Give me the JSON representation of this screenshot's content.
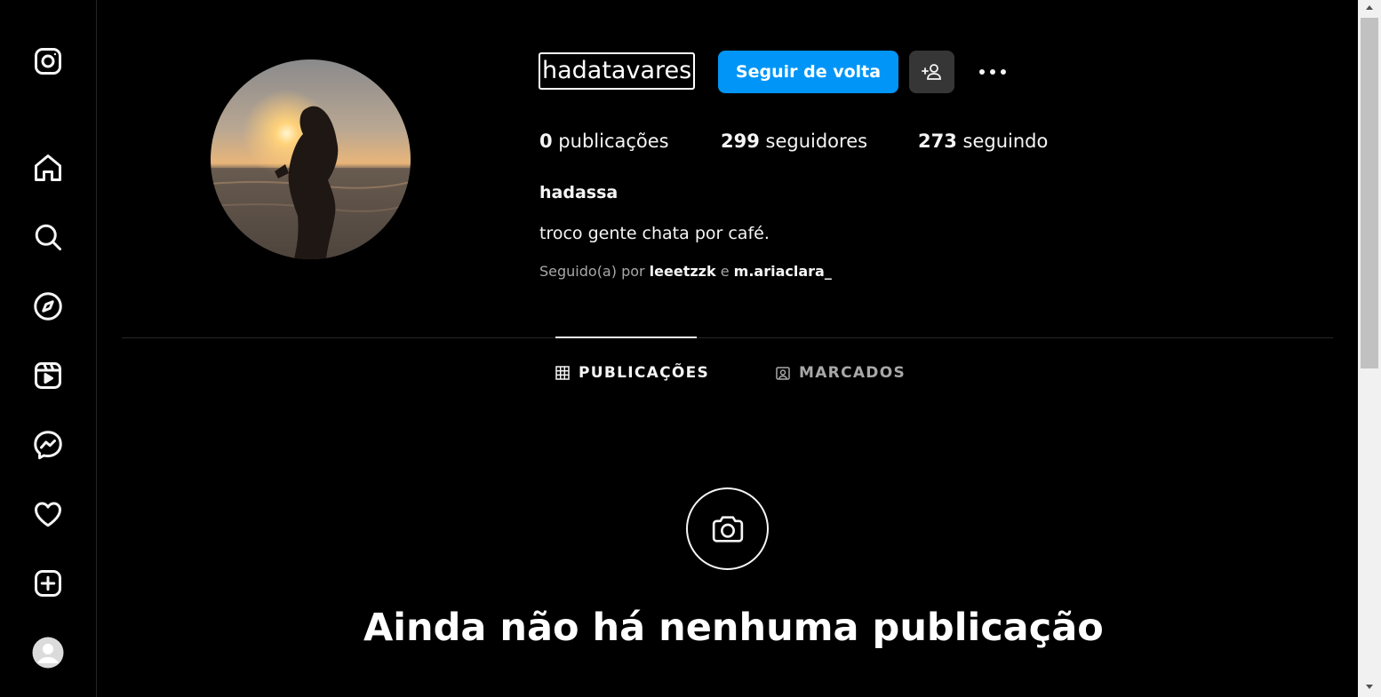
{
  "sidebar": {
    "items": [
      {
        "icon": "instagram-logo-icon"
      },
      {
        "icon": "home-icon"
      },
      {
        "icon": "search-icon"
      },
      {
        "icon": "explore-compass-icon"
      },
      {
        "icon": "reels-icon"
      },
      {
        "icon": "messenger-icon"
      },
      {
        "icon": "heart-icon"
      },
      {
        "icon": "create-plus-icon"
      },
      {
        "icon": "profile-avatar-icon"
      }
    ]
  },
  "profile": {
    "username": "hadatavares",
    "follow_label": "Seguir de volta",
    "more_label": "•••",
    "stats": {
      "posts_count": "0",
      "posts_label": " publicações",
      "followers_count": "299",
      "followers_label": " seguidores",
      "following_count": "273",
      "following_label": " seguindo"
    },
    "full_name": "hadassa",
    "bio": "troco gente chata por café.",
    "followed_by": {
      "prefix": "Seguido(a) por ",
      "user1": "leeetzzk",
      "joiner": " e ",
      "user2": "m.ariaclara_"
    }
  },
  "tabs": [
    {
      "label": "PUBLICAÇÕES",
      "active": true,
      "icon": "grid-icon"
    },
    {
      "label": "MARCADOS",
      "active": false,
      "icon": "tagged-icon"
    }
  ],
  "empty_state": {
    "icon": "camera-icon",
    "title": "Ainda não há nenhuma publicação"
  },
  "colors": {
    "background": "#000000",
    "accent": "#0095f6",
    "secondary_button": "#363636",
    "muted_text": "#a8a8a8"
  }
}
